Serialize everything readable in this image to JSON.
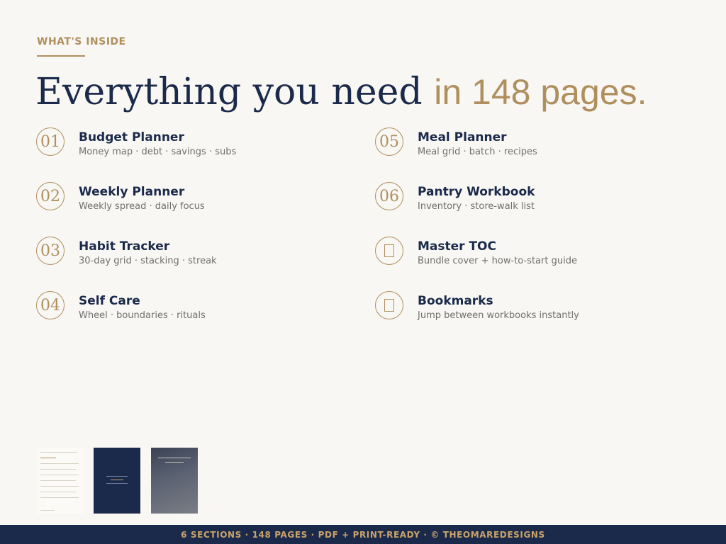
{
  "header": {
    "eyebrow": "WHAT'S INSIDE",
    "headline_main": "Everything you need",
    "headline_accent": "in 148 pages."
  },
  "sections": [
    {
      "badge": "01",
      "title": "Budget Planner",
      "subtitle": "Money map · debt · savings · subs"
    },
    {
      "badge": "02",
      "title": "Weekly Planner",
      "subtitle": "Weekly spread · daily focus"
    },
    {
      "badge": "03",
      "title": "Habit Tracker",
      "subtitle": "30-day grid · stacking · streak"
    },
    {
      "badge": "04",
      "title": "Self Care",
      "subtitle": "Wheel · boundaries · rituals"
    },
    {
      "badge": "05",
      "title": "Meal Planner",
      "subtitle": "Meal grid · batch · recipes"
    },
    {
      "badge": "06",
      "title": "Pantry Workbook",
      "subtitle": "Inventory · store-walk list"
    },
    {
      "badge_icon": "book-icon",
      "title": "Master TOC",
      "subtitle": "Bundle cover + how-to-start guide"
    },
    {
      "badge_icon": "bookmark-icon",
      "title": "Bookmarks",
      "subtitle": "Jump between workbooks instantly"
    }
  ],
  "footer": {
    "text": "6 SECTIONS · 148 PAGES · PDF + PRINT-READY · © THEOMAREDESIGNS"
  },
  "colors": {
    "navy": "#1b2a4a",
    "gold": "#b08f5e",
    "background": "#f8f7f4"
  }
}
